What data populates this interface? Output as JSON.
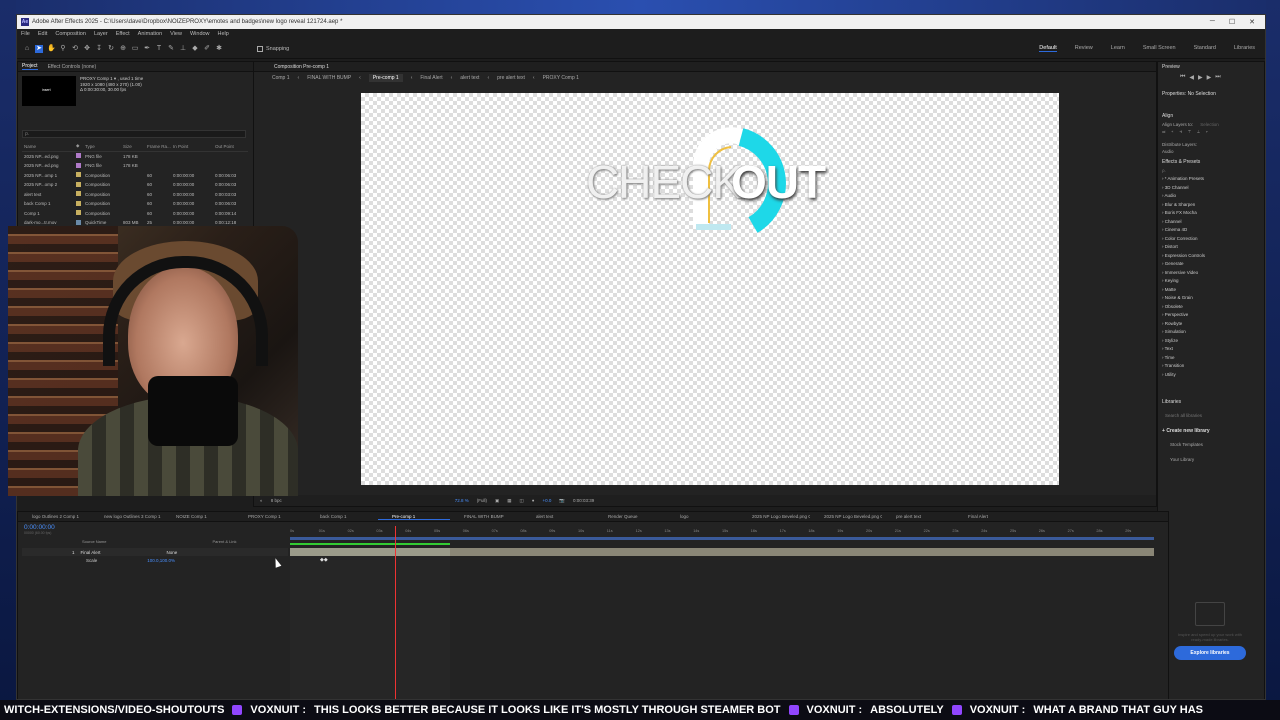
{
  "window": {
    "title": "Adobe After Effects 2025 - C:\\Users\\dave\\Dropbox\\NOIZEPROXY\\emotes and badges\\new logo reveal 121724.aep *"
  },
  "menu": [
    "File",
    "Edit",
    "Composition",
    "Layer",
    "Effect",
    "Animation",
    "View",
    "Window",
    "Help"
  ],
  "toolbar": {
    "snapping_label": "Snapping"
  },
  "workspaces": [
    "Default",
    "Review",
    "Learn",
    "Small Screen",
    "Standard",
    "Libraries"
  ],
  "project_panel": {
    "tabs": [
      "Project",
      "Effect Controls (none)"
    ],
    "thumb_text": "insert",
    "info_lines": [
      "PROXY Comp 1 ▾ , used 1 time",
      "1920 x 1080 (480 x 270) (1.00)",
      "Δ 0:00:30:00, 30.00 fps"
    ],
    "search_placeholder": "ρ.",
    "columns": [
      "Name",
      "",
      "Type",
      "Size",
      "Frame Ra...",
      "In Point",
      "Out Point"
    ],
    "rows": [
      {
        "name": "2025 NP...ed.png",
        "color": "#b07ac8",
        "type": "PNG file",
        "size": "178 KB",
        "fr": "",
        "in": "",
        "out": ""
      },
      {
        "name": "2025 NP...ed.png",
        "color": "#b07ac8",
        "type": "PNG file",
        "size": "178 KB",
        "fr": "",
        "in": "",
        "out": ""
      },
      {
        "name": "2025 NP...omp 1",
        "color": "#c8b060",
        "type": "Composition",
        "size": "",
        "fr": "60",
        "in": "0:00:00:00",
        "out": "0:00:06:03"
      },
      {
        "name": "2025 NP...omp 2",
        "color": "#c8b060",
        "type": "Composition",
        "size": "",
        "fr": "60",
        "in": "0:00:00:00",
        "out": "0:00:06:03"
      },
      {
        "name": "alert text",
        "color": "#c8b060",
        "type": "Composition",
        "size": "",
        "fr": "60",
        "in": "0:00:00:00",
        "out": "0:00:03:03"
      },
      {
        "name": "back Comp 1",
        "color": "#c8b060",
        "type": "Composition",
        "size": "",
        "fr": "60",
        "in": "0:00:00:00",
        "out": "0:00:06:03"
      },
      {
        "name": "Comp 1",
        "color": "#c8b060",
        "type": "Composition",
        "size": "",
        "fr": "60",
        "in": "0:00:00:00",
        "out": "0:00:09:14"
      },
      {
        "name": "dark-mo...tr.mov",
        "color": "#6a8aa8",
        "type": "QuickTime",
        "size": "803 MB",
        "fr": "25",
        "in": "0:00:00:00",
        "out": "0:00:12:18"
      }
    ]
  },
  "composition": {
    "header": "Composition Pre-comp 1",
    "breadcrumbs": [
      "Comp 1",
      "FINAL WITH BUMP",
      "Pre-comp 1",
      "Final Alert",
      "alert text",
      "pre alert text",
      "PROXY Comp 1"
    ],
    "active_crumb": "Pre-comp 1",
    "logo_word_1": "CHECK",
    "logo_word_2": "OUT",
    "footer": {
      "bpc": "8 bpc",
      "zoom": "72.8 %",
      "resolution": "(Full)",
      "exposure": "+0.0",
      "timecode": "0:00:03:39"
    }
  },
  "right_panel": {
    "preview_title": "Preview",
    "properties_title": "Properties: No Selection",
    "align_title": "Align",
    "align_layers_to_label": "Align Layers to:",
    "align_layers_to_value": "Selection",
    "distribute_label": "Distribute Layers:",
    "audio_label": "Audio",
    "effects_title": "Effects & Presets",
    "effects_search_placeholder": "ρ.",
    "effects": [
      "* Animation Presets",
      "3D Channel",
      "Audio",
      "Blur & Sharpen",
      "Boris FX Mocha",
      "Channel",
      "Cinema 4D",
      "Color Correction",
      "Distort",
      "Expression Controls",
      "Generate",
      "Immersive Video",
      "Keying",
      "Matte",
      "Noise & Grain",
      "Obsolete",
      "Perspective",
      "Rowbyte",
      "Simulation",
      "Stylize",
      "Text",
      "Time",
      "Transition",
      "Utility"
    ],
    "libraries_title": "Libraries",
    "libraries_search_placeholder": "Search all libraries",
    "create_library": "Create new library",
    "stock_templates": "Stock Templates",
    "your_library": "Your Library",
    "promo_text": "Inspire and speed up your work with ready-made libraries.",
    "explore_button": "Explore libraries"
  },
  "timeline": {
    "tabs": [
      "logo Outlines 2 Comp 1",
      "new logo Outlines 3 Comp 1",
      "NOIZE Comp 1",
      "PROXY Comp 1",
      "back Comp 1",
      "Pre-comp 1",
      "FINAL WITH BUMP",
      "alert text",
      "Render Queue",
      "logo",
      "2025 NP Logo Beveled.png Comp 1",
      "2025 NP Logo Beveled.png Comp 2",
      "pre alert text",
      "Final Alert"
    ],
    "active_tab": "Pre-comp 1",
    "timecode": "0:00:00:00",
    "timecode_sub": "00000 (60.00 fps)",
    "columns": [
      "Source Name",
      "Parent & Link"
    ],
    "layer": {
      "index": "1",
      "name": "Final Alert",
      "parent": "None"
    },
    "property": {
      "name": "Scale",
      "value": "100.0,100.0%"
    },
    "ruler_ticks": [
      "0s",
      "01s",
      "02s",
      "03s",
      "04s",
      "05s",
      "06s",
      "07s",
      "08s",
      "09s",
      "10s",
      "11s",
      "12s",
      "13s",
      "14s",
      "15s",
      "16s",
      "17s",
      "18s",
      "19s",
      "20s",
      "21s",
      "22s",
      "23s",
      "24s",
      "25s",
      "26s",
      "27s",
      "28s",
      "29s"
    ],
    "playhead_time_s": 3.65
  },
  "chat_ticker": {
    "segments": [
      {
        "user": "",
        "text": "WITCH-EXTENSIONS/VIDEO-SHOUTOUTS"
      },
      {
        "user": "VOXNUIT",
        "text": "THIS LOOKS BETTER BECAUSE IT LOOKS LIKE IT'S MOSTLY THROUGH STEAMER BOT"
      },
      {
        "user": "VOXNUIT",
        "text": "ABSOLUTELY"
      },
      {
        "user": "VOXNUIT",
        "text": "WHAT A BRAND THAT GUY HAS"
      }
    ]
  }
}
